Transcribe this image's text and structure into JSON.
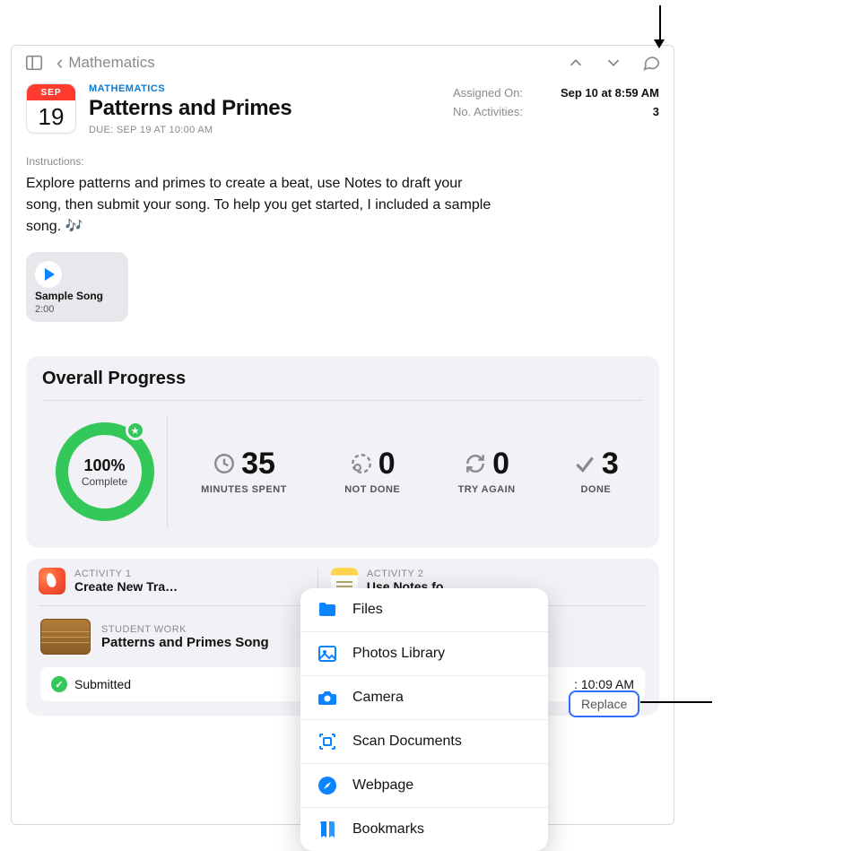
{
  "nav": {
    "back_label": "Mathematics"
  },
  "calendar": {
    "month": "SEP",
    "day": "19"
  },
  "header": {
    "subject": "MATHEMATICS",
    "title": "Patterns and Primes",
    "due": "DUE: SEP 19 AT 10:00 AM"
  },
  "meta": {
    "assigned_label": "Assigned On:",
    "assigned_value": "Sep 10 at 8:59 AM",
    "activities_label": "No. Activities:",
    "activities_value": "3"
  },
  "instructions": {
    "label": "Instructions:",
    "body": "Explore patterns and primes to create a beat, use Notes to draft your song, then submit your song. To help you get started, I included a sample song. 🎶"
  },
  "attachment": {
    "name": "Sample Song",
    "duration": "2:00"
  },
  "progress": {
    "title": "Overall Progress",
    "ring_percent": "100%",
    "ring_caption": "Complete",
    "stats": [
      {
        "value": "35",
        "label": "MINUTES SPENT",
        "icon": "clock"
      },
      {
        "value": "0",
        "label": "NOT DONE",
        "icon": "notdone"
      },
      {
        "value": "0",
        "label": "TRY AGAIN",
        "icon": "refresh"
      },
      {
        "value": "3",
        "label": "DONE",
        "icon": "check"
      }
    ]
  },
  "activities": [
    {
      "label": "ACTIVITY 1",
      "name": "Create New Tra…",
      "app": "garageband"
    },
    {
      "label": "ACTIVITY 2",
      "name": "Use Notes fo",
      "app": "notes"
    }
  ],
  "work": {
    "label": "STUDENT WORK",
    "name": "Patterns and Primes Song",
    "status": "Submitted",
    "time_fragment": ": 10:09 AM"
  },
  "replace_label": "Replace",
  "popup": [
    {
      "icon": "folder",
      "label": "Files"
    },
    {
      "icon": "photo",
      "label": "Photos Library"
    },
    {
      "icon": "camera",
      "label": "Camera"
    },
    {
      "icon": "scan",
      "label": "Scan Documents"
    },
    {
      "icon": "safari",
      "label": "Webpage"
    },
    {
      "icon": "bookmark",
      "label": "Bookmarks"
    }
  ]
}
